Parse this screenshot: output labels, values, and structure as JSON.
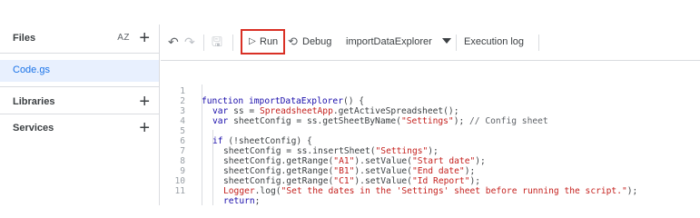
{
  "sidebar": {
    "files_label": "Files",
    "sort_label": "AZ",
    "add_symbol": "+",
    "file_name": "Code.gs",
    "libraries_label": "Libraries",
    "services_label": "Services"
  },
  "toolbar": {
    "undo_glyph": "↶",
    "redo_glyph": "↷",
    "save_glyph": "🖫",
    "run_glyph": "▷",
    "run_label": "Run",
    "debug_glyph": "⟲",
    "debug_label": "Debug",
    "function_name": "importDataExplorer",
    "execution_log_label": "Execution log"
  },
  "code_lines": [
    {
      "n": "1",
      "t": "function importDataExplorer() {"
    },
    {
      "n": "2",
      "t": "var ss = SpreadsheetApp.getActiveSpreadsheet();"
    },
    {
      "n": "3",
      "t": "var sheetConfig = ss.getSheetByName(\"Settings\"); // Config sheet"
    },
    {
      "n": "4",
      "t": ""
    },
    {
      "n": "5",
      "t": "if (!sheetConfig) {"
    },
    {
      "n": "6",
      "t": "sheetConfig = ss.insertSheet(\"Settings\");"
    },
    {
      "n": "7",
      "t": "sheetConfig.getRange(\"A1\").setValue(\"Start date\");"
    },
    {
      "n": "8",
      "t": "sheetConfig.getRange(\"B1\").setValue(\"End date\");"
    },
    {
      "n": "9",
      "t": "sheetConfig.getRange(\"C1\").setValue(\"Id Report\");"
    },
    {
      "n": "10",
      "t": "Logger.log(\"Set the dates in the 'Settings' sheet before running the script.\");"
    },
    {
      "n": "11",
      "t": "return;"
    }
  ],
  "colors": {
    "accent_blue": "#1a73e8",
    "run_highlight": "#d93025",
    "keyword": "#1a0dab",
    "string": "#c5221f"
  }
}
